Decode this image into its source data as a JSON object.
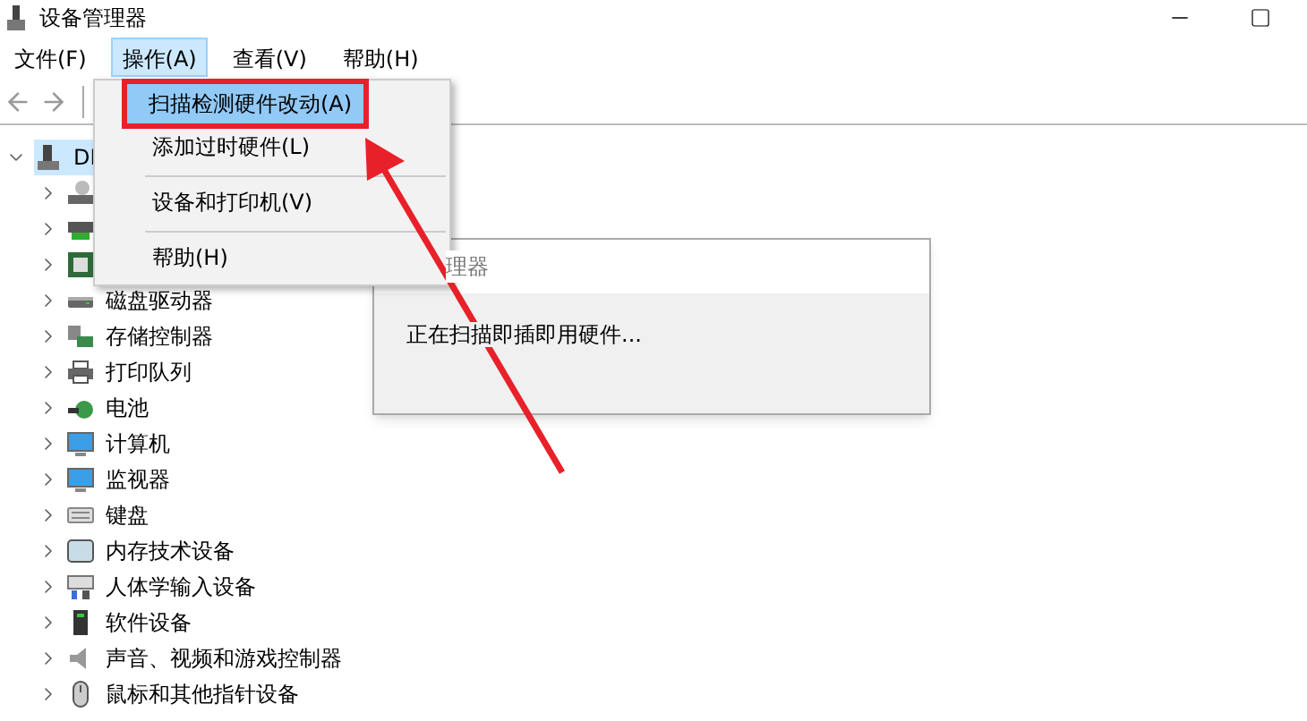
{
  "window": {
    "title": "设备管理器"
  },
  "menu_bar": [
    {
      "label": "文件(F)",
      "selected": false
    },
    {
      "label": "操作(A)",
      "selected": true
    },
    {
      "label": "查看(V)",
      "selected": false
    },
    {
      "label": "帮助(H)",
      "selected": false
    }
  ],
  "tree": [
    {
      "label": "DI",
      "kind": "computer-root",
      "expanded": true,
      "selected": true,
      "children": [
        {
          "kind": "dvd",
          "expanded": false,
          "selected": false
        },
        {
          "kind": "network",
          "expanded": false,
          "selected": false
        },
        {
          "kind": "chip",
          "expanded": false,
          "selected": false
        },
        {
          "label": "磁盘驱动器",
          "kind": "disk",
          "expanded": false,
          "selected": false
        },
        {
          "label": "存储控制器",
          "kind": "storage",
          "expanded": false,
          "selected": false
        },
        {
          "label": "打印队列",
          "kind": "printer",
          "expanded": false,
          "selected": false
        },
        {
          "label": "电池",
          "kind": "battery",
          "expanded": false,
          "selected": false
        },
        {
          "label": "计算机",
          "kind": "monitor",
          "expanded": false,
          "selected": false
        },
        {
          "label": "监视器",
          "kind": "monitor",
          "expanded": false,
          "selected": false
        },
        {
          "label": "键盘",
          "kind": "keyboard",
          "expanded": false,
          "selected": false
        },
        {
          "label": "内存技术设备",
          "kind": "memory",
          "expanded": false,
          "selected": false
        },
        {
          "label": "人体学输入设备",
          "kind": "hid",
          "expanded": false,
          "selected": false
        },
        {
          "label": "软件设备",
          "kind": "software",
          "expanded": false,
          "selected": false
        },
        {
          "label": "声音、视频和游戏控制器",
          "kind": "sound",
          "expanded": false,
          "selected": false
        },
        {
          "label": "鼠标和其他指针设备",
          "kind": "mouse",
          "expanded": false,
          "selected": false
        }
      ]
    }
  ],
  "dropdown_menu": [
    {
      "kind": "item",
      "label": "扫描检测硬件改动(A)",
      "selected": true,
      "annotated": true
    },
    {
      "kind": "item",
      "label": "添加过时硬件(L)",
      "selected": false,
      "annotated": false
    },
    {
      "kind": "separator"
    },
    {
      "kind": "item",
      "label": "设备和打印机(V)",
      "selected": false,
      "annotated": false
    },
    {
      "kind": "separator"
    },
    {
      "kind": "item",
      "label": "帮助(H)",
      "selected": false,
      "annotated": false
    }
  ],
  "dialog": {
    "title": "理器",
    "message": "正在扫描即插即用硬件..."
  },
  "annotation": {
    "kind": "arrow"
  }
}
